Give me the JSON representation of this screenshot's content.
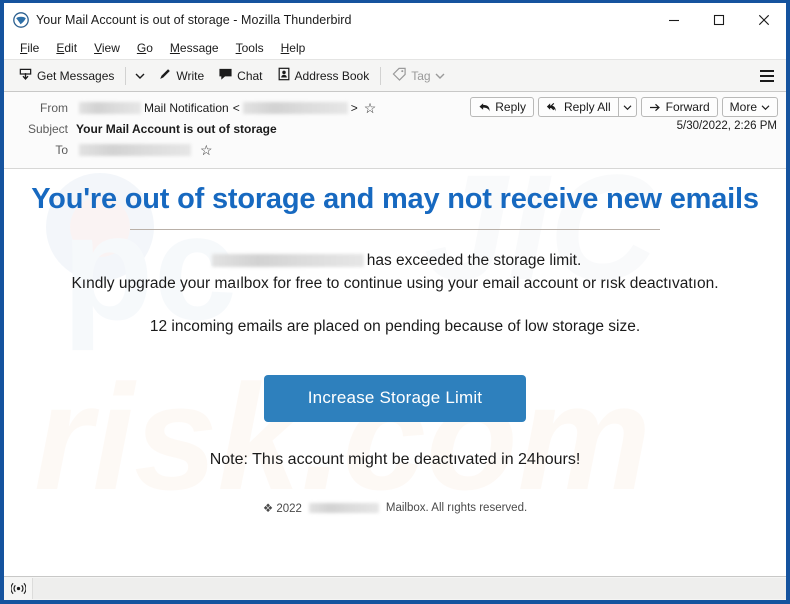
{
  "window": {
    "title": "Your Mail Account is out of storage - Mozilla Thunderbird",
    "app_icon": "thunderbird-icon",
    "controls": {
      "minimize": "minimize-icon",
      "maximize": "maximize-icon",
      "close": "close-icon"
    }
  },
  "menubar": {
    "items": [
      {
        "label": "File",
        "accel": "F"
      },
      {
        "label": "Edit",
        "accel": "E"
      },
      {
        "label": "View",
        "accel": "V"
      },
      {
        "label": "Go",
        "accel": "G"
      },
      {
        "label": "Message",
        "accel": "M"
      },
      {
        "label": "Tools",
        "accel": "T"
      },
      {
        "label": "Help",
        "accel": "H"
      }
    ]
  },
  "toolbar": {
    "get_messages": "Get Messages",
    "write": "Write",
    "chat": "Chat",
    "address_book": "Address Book",
    "tag": "Tag",
    "app_menu": "hamburger-menu-icon"
  },
  "message_header": {
    "from_label": "From",
    "from_display_name": "Mail Notification",
    "from_bracket_open": "<",
    "from_bracket_close": ">",
    "subject_label": "Subject",
    "subject_value": "Your Mail Account is out of storage",
    "to_label": "To",
    "date": "5/30/2022, 2:26 PM",
    "actions": {
      "reply": "Reply",
      "reply_all": "Reply All",
      "forward": "Forward",
      "more": "More"
    }
  },
  "email": {
    "headline": "You're out of storage and may not receive new emails",
    "paragraph1_suffix": "has exceeded the storage limit.",
    "paragraph1_line2": "Kındly upgrade your maılbox for free to continue using your email account or rısk deactıvatıon.",
    "paragraph2": "12 incoming emails are placed on pending because of low storage size.",
    "cta_label": "Increase Storage Limit",
    "note": "Note: Thıs account might be deactıvated in 24hours!",
    "copyright_prefix": "❖ 2022",
    "copyright_suffix": "Mailbox. All rıghts reserved.",
    "colors": {
      "headline": "#1769c0",
      "cta_background": "#2e80bd",
      "cta_text": "#ffffff"
    },
    "watermark": "pcrisk.com"
  },
  "statusbar": {
    "icon": "broadcast-icon"
  }
}
